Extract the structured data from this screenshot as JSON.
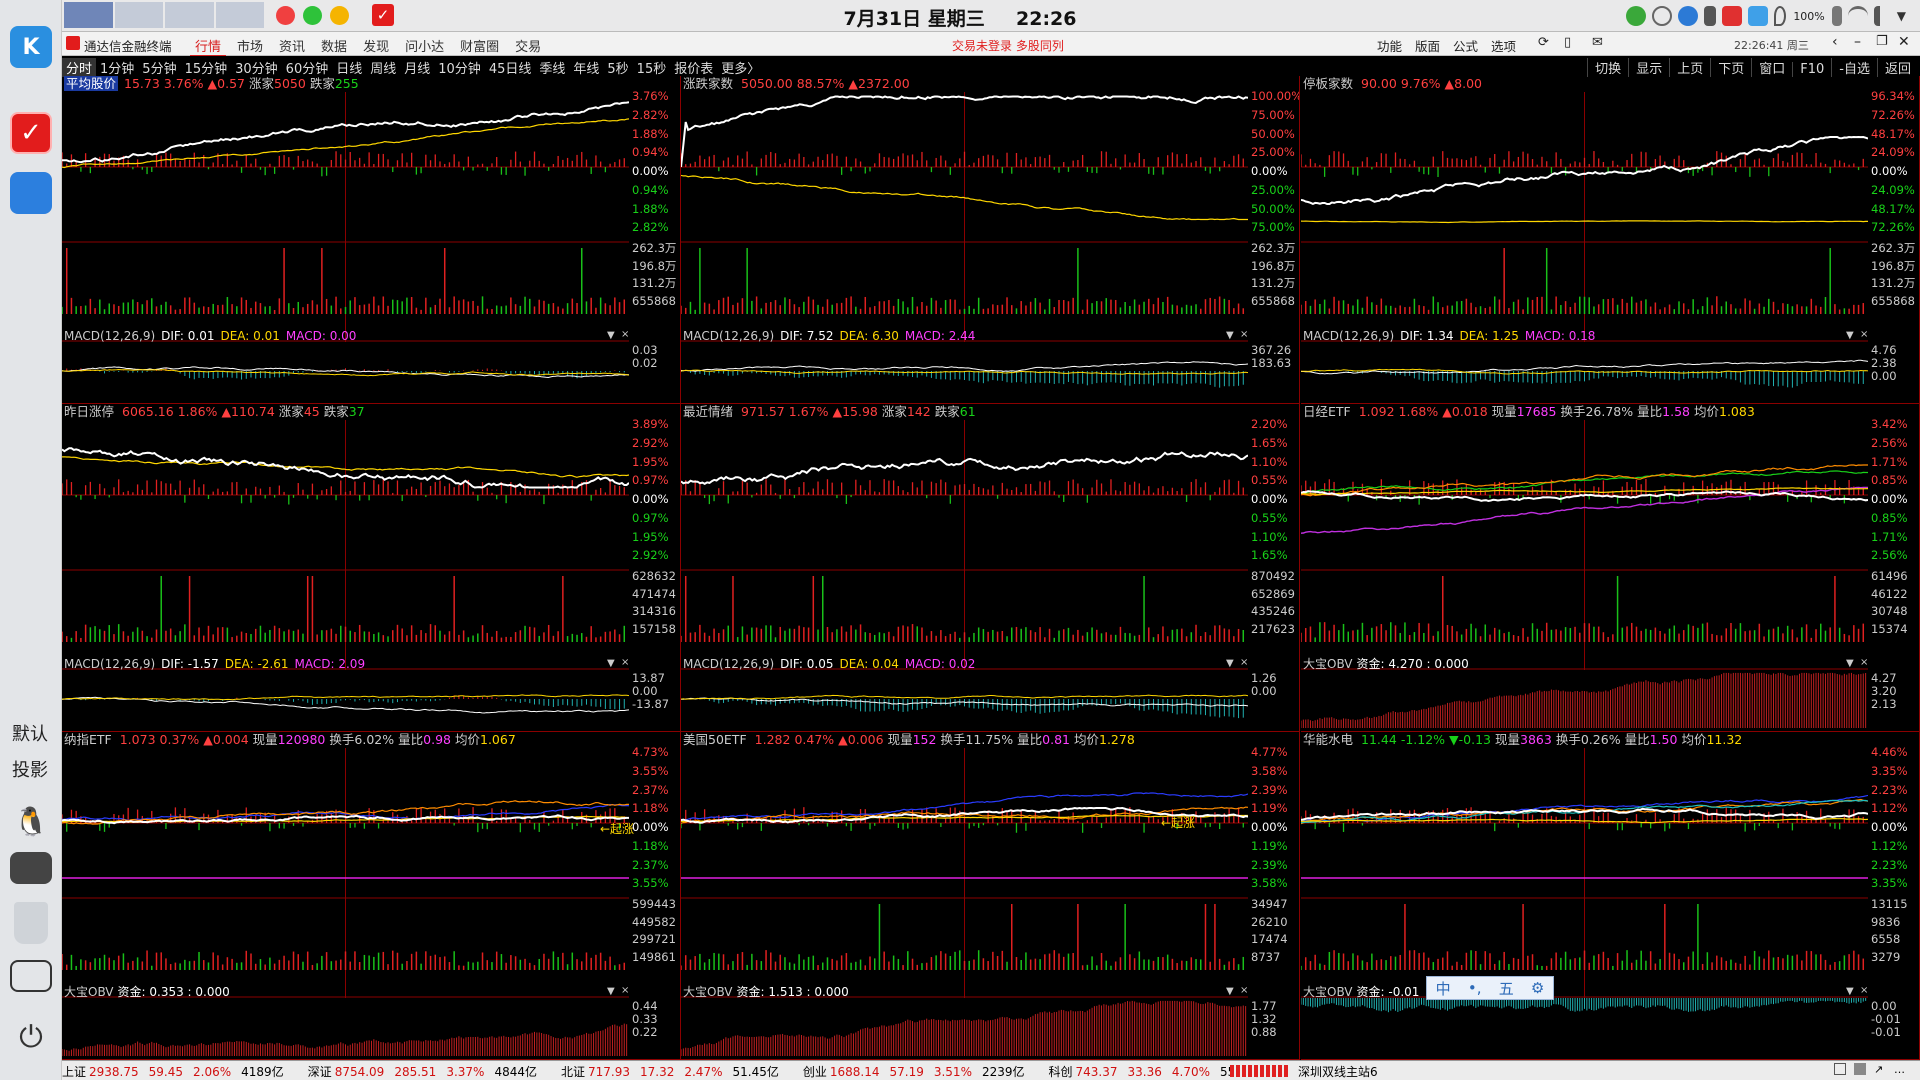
{
  "sysbar": {
    "date": "7月31日 星期三",
    "time": "22:26",
    "battery": "100%"
  },
  "dock": {
    "default_label": "默认",
    "cast_label": "投影"
  },
  "menubar": {
    "app_title": "通达信金融终端",
    "tabs": [
      "行情",
      "市场",
      "资讯",
      "数据",
      "发现",
      "问小达",
      "财富圈",
      "交易"
    ],
    "notice": "交易未登录  多股同列",
    "right_items": [
      "功能",
      "版面",
      "公式",
      "选项"
    ],
    "clock": "22:26:41 周三"
  },
  "periodbar": {
    "periods": [
      "分时",
      "1分钟",
      "5分钟",
      "15分钟",
      "30分钟",
      "60分钟",
      "日线",
      "周线",
      "月线",
      "10分钟",
      "45日线",
      "季线",
      "年线",
      "5秒",
      "15秒",
      "报价表",
      "更多〉"
    ],
    "right": [
      "切换",
      "显示",
      "上页",
      "下页",
      "窗口",
      "F10",
      "-自选",
      "返回"
    ]
  },
  "panels": [
    {
      "name": "平均股价",
      "value": "15.73",
      "pct": "3.76%",
      "chg": "▲0.57",
      "up_label": "涨家",
      "up": "5050",
      "down_label": "跌家",
      "down": "255",
      "y_top": [
        "3.76%",
        "2.82%",
        "1.88%",
        "0.94%",
        "0.00%",
        "0.94%",
        "1.88%",
        "2.82%"
      ],
      "y_vol": [
        "262.3万",
        "196.8万",
        "131.2万",
        "655868"
      ],
      "macd": {
        "label": "MACD(12,26,9)",
        "dif": "DIF: 0.01",
        "dea": "DEA: 0.01",
        "macd": "MACD: 0.00",
        "y": [
          "0.03",
          "0.02"
        ]
      }
    },
    {
      "name": "涨跌家数",
      "value": "5050.00",
      "pct": "88.57%",
      "chg": "▲2372.00",
      "y_top": [
        "100.00%",
        "75.00%",
        "50.00%",
        "25.00%",
        "0.00%",
        "25.00%",
        "50.00%",
        "75.00%"
      ],
      "y_vol": [
        "262.3万",
        "196.8万",
        "131.2万",
        "655868"
      ],
      "macd": {
        "label": "MACD(12,26,9)",
        "dif": "DIF: 7.52",
        "dea": "DEA: 6.30",
        "macd": "MACD: 2.44",
        "y": [
          "367.26",
          "183.63"
        ]
      }
    },
    {
      "name": "停板家数",
      "value": "90.00",
      "pct": "9.76%",
      "chg": "▲8.00",
      "y_top": [
        "96.34%",
        "72.26%",
        "48.17%",
        "24.09%",
        "0.00%",
        "24.09%",
        "48.17%",
        "72.26%"
      ],
      "y_vol": [
        "262.3万",
        "196.8万",
        "131.2万",
        "655868"
      ],
      "macd": {
        "label": "MACD(12,26,9)",
        "dif": "DIF: 1.34",
        "dea": "DEA: 1.25",
        "macd": "MACD: 0.18",
        "y": [
          "4.76",
          "2.38",
          "0.00"
        ]
      }
    },
    {
      "name": "昨日涨停",
      "value": "6065.16",
      "pct": "1.86%",
      "chg": "▲110.74",
      "up_label": "涨家",
      "up": "45",
      "down_label": "跌家",
      "down": "37",
      "y_top": [
        "3.89%",
        "2.92%",
        "1.95%",
        "0.97%",
        "0.00%",
        "0.97%",
        "1.95%",
        "2.92%"
      ],
      "y_vol": [
        "628632",
        "471474",
        "314316",
        "157158"
      ],
      "macd": {
        "label": "MACD(12,26,9)",
        "dif": "DIF: -1.57",
        "dea": "DEA: -2.61",
        "macd": "MACD: 2.09",
        "y": [
          "13.87",
          "0.00",
          "-13.87"
        ]
      }
    },
    {
      "name": "最近情绪",
      "value": "971.57",
      "pct": "1.67%",
      "chg": "▲15.98",
      "up_label": "涨家",
      "up": "142",
      "down_label": "跌家",
      "down": "61",
      "y_top": [
        "2.20%",
        "1.65%",
        "1.10%",
        "0.55%",
        "0.00%",
        "0.55%",
        "1.10%",
        "1.65%"
      ],
      "y_vol": [
        "870492",
        "652869",
        "435246",
        "217623"
      ],
      "macd": {
        "label": "MACD(12,26,9)",
        "dif": "DIF: 0.05",
        "dea": "DEA: 0.04",
        "macd": "MACD: 0.02",
        "y": [
          "1.26",
          "0.00"
        ]
      }
    },
    {
      "name": "日经ETF",
      "value": "1.092",
      "pct": "1.68%",
      "chg": "▲0.018",
      "vol_label": "现量",
      "vol": "17685",
      "turn_label": "换手",
      "turn": "26.78%",
      "ratio_label": "量比",
      "ratio": "1.58",
      "avg_label": "均价",
      "avg": "1.083",
      "y_top": [
        "3.42%",
        "2.56%",
        "1.71%",
        "0.85%",
        "0.00%",
        "0.85%",
        "1.71%",
        "2.56%"
      ],
      "y_vol": [
        "61496",
        "46122",
        "30748",
        "15374"
      ],
      "obv": {
        "label": "大宝OBV",
        "fund": "资金: 4.270 : 0.000",
        "y": [
          "4.27",
          "3.20",
          "2.13"
        ]
      }
    },
    {
      "name": "纳指ETF",
      "value": "1.073",
      "pct": "0.37%",
      "chg": "▲0.004",
      "vol_label": "现量",
      "vol": "120980",
      "turn_label": "换手",
      "turn": "6.02%",
      "ratio_label": "量比",
      "ratio": "0.98",
      "avg_label": "均价",
      "avg": "1.067",
      "y_top": [
        "4.73%",
        "3.55%",
        "2.37%",
        "1.18%",
        "0.00%",
        "1.18%",
        "2.37%",
        "3.55%"
      ],
      "y_vol": [
        "599443",
        "449582",
        "299721",
        "149861"
      ],
      "annotation": "←起涨",
      "obv": {
        "label": "大宝OBV",
        "fund": "资金: 0.353 : 0.000",
        "y": [
          "0.44",
          "0.33",
          "0.22"
        ]
      }
    },
    {
      "name": "美国50ETF",
      "value": "1.282",
      "pct": "0.47%",
      "chg": "▲0.006",
      "vol_label": "现量",
      "vol": "152",
      "turn_label": "换手",
      "turn": "11.75%",
      "ratio_label": "量比",
      "ratio": "0.81",
      "avg_label": "均价",
      "avg": "1.278",
      "y_top": [
        "4.77%",
        "3.58%",
        "2.39%",
        "1.19%",
        "0.00%",
        "1.19%",
        "2.39%",
        "3.58%"
      ],
      "y_vol": [
        "34947",
        "26210",
        "17474",
        "8737"
      ],
      "annotation": "←起涨",
      "obv": {
        "label": "大宝OBV",
        "fund": "资金: 1.513 : 0.000",
        "y": [
          "1.77",
          "1.32",
          "0.88"
        ]
      }
    },
    {
      "name": "华能水电",
      "value": "11.44",
      "pct": "-1.12%",
      "chg": "▼-0.13",
      "vol_label": "现量",
      "vol": "3863",
      "turn_label": "换手",
      "turn": "0.26%",
      "ratio_label": "量比",
      "ratio": "1.50",
      "avg_label": "均价",
      "avg": "11.32",
      "y_top": [
        "4.46%",
        "3.35%",
        "2.23%",
        "1.12%",
        "0.00%",
        "1.12%",
        "2.23%",
        "3.35%"
      ],
      "y_vol": [
        "13115",
        "9836",
        "6558",
        "3279"
      ],
      "obv": {
        "label": "大宝OBV",
        "fund": "资金: -0.01",
        "y": [
          "0.00",
          "-0.01",
          "-0.01"
        ]
      }
    }
  ],
  "ime": {
    "chars": [
      "中",
      "•,",
      "五",
      "⚙"
    ]
  },
  "status": {
    "items": [
      {
        "name": "上证",
        "v": "2938.75",
        "c": "59.45",
        "p": "2.06%",
        "a": "4189亿"
      },
      {
        "name": "深证",
        "v": "8754.09",
        "c": "285.51",
        "p": "3.37%",
        "a": "4844亿"
      },
      {
        "name": "北证",
        "v": "717.93",
        "c": "17.32",
        "p": "2.47%",
        "a": "51.45亿"
      },
      {
        "name": "创业",
        "v": "1688.14",
        "c": "57.19",
        "p": "3.51%",
        "a": "2239亿"
      },
      {
        "name": "科创",
        "v": "743.37",
        "c": "33.36",
        "p": "4.70%",
        "a": "558.9亿"
      }
    ],
    "server": "深圳双线主站6"
  },
  "colors": {
    "up": "#ff4040",
    "down": "#19d219",
    "price": "#ffffff",
    "avg": "#ffd700",
    "grid": "#8b0000"
  }
}
